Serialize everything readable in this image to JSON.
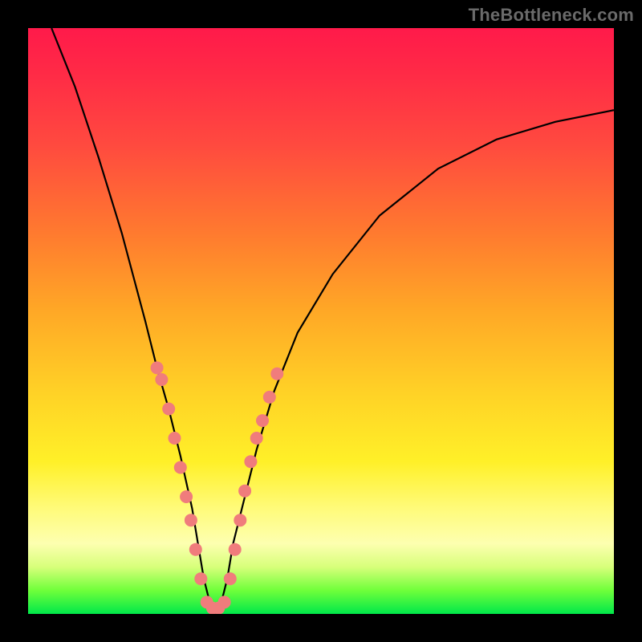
{
  "watermark": "TheBottleneck.com",
  "chart_data": {
    "type": "line",
    "title": "",
    "xlabel": "",
    "ylabel": "",
    "xlim": [
      0,
      100
    ],
    "ylim": [
      0,
      100
    ],
    "grid": false,
    "legend": false,
    "series": [
      {
        "name": "curve",
        "color": "#000000",
        "x": [
          4,
          8,
          12,
          16,
          20,
          22,
          24,
          26,
          28,
          29,
          30,
          31,
          32,
          33,
          34,
          35,
          37,
          39,
          42,
          46,
          52,
          60,
          70,
          80,
          90,
          100
        ],
        "y": [
          100,
          90,
          78,
          65,
          50,
          42,
          35,
          27,
          18,
          12,
          6,
          2,
          0,
          2,
          6,
          12,
          20,
          28,
          38,
          48,
          58,
          68,
          76,
          81,
          84,
          86
        ]
      }
    ],
    "markers": [
      {
        "name": "dots",
        "color": "#f07c7c",
        "radius_px": 8,
        "points": [
          {
            "x": 22.0,
            "y": 42
          },
          {
            "x": 22.8,
            "y": 40
          },
          {
            "x": 24.0,
            "y": 35
          },
          {
            "x": 25.0,
            "y": 30
          },
          {
            "x": 26.0,
            "y": 25
          },
          {
            "x": 27.0,
            "y": 20
          },
          {
            "x": 27.8,
            "y": 16
          },
          {
            "x": 28.6,
            "y": 11
          },
          {
            "x": 29.5,
            "y": 6
          },
          {
            "x": 30.5,
            "y": 2
          },
          {
            "x": 31.5,
            "y": 1
          },
          {
            "x": 32.5,
            "y": 1
          },
          {
            "x": 33.5,
            "y": 2
          },
          {
            "x": 34.5,
            "y": 6
          },
          {
            "x": 35.3,
            "y": 11
          },
          {
            "x": 36.2,
            "y": 16
          },
          {
            "x": 37.0,
            "y": 21
          },
          {
            "x": 38.0,
            "y": 26
          },
          {
            "x": 39.0,
            "y": 30
          },
          {
            "x": 40.0,
            "y": 33
          },
          {
            "x": 41.2,
            "y": 37
          },
          {
            "x": 42.5,
            "y": 41
          }
        ]
      }
    ]
  }
}
